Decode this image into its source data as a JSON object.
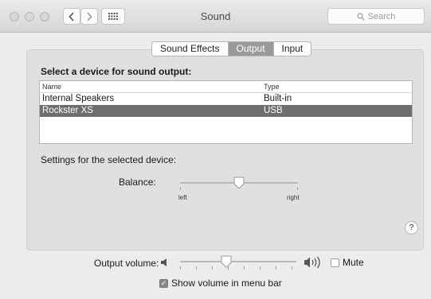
{
  "window": {
    "title": "Sound",
    "search_placeholder": "Search"
  },
  "icons": {
    "back": "chevron-left-icon",
    "forward": "chevron-right-icon",
    "show_all": "grid-icon",
    "search": "magnifier-icon",
    "volume_low": "speaker-low-icon",
    "volume_high": "speaker-high-icon"
  },
  "tabs": [
    {
      "label": "Sound Effects",
      "active": false
    },
    {
      "label": "Output",
      "active": true
    },
    {
      "label": "Input",
      "active": false
    }
  ],
  "output": {
    "heading": "Select a device for sound output:",
    "columns": {
      "name": "Name",
      "type": "Type"
    },
    "devices": [
      {
        "name": "Internal Speakers",
        "type": "Built-in",
        "selected": false
      },
      {
        "name": "Rockster XS",
        "type": "USB",
        "selected": true
      }
    ],
    "settings_label": "Settings for the selected device:",
    "balance": {
      "label": "Balance:",
      "left_label": "left",
      "right_label": "right",
      "value": 0.5
    }
  },
  "footer": {
    "output_volume_label": "Output volume:",
    "output_volume_value": 0.4,
    "mute_label": "Mute",
    "mute_checked": false,
    "show_volume_label": "Show volume in menu bar",
    "show_volume_checked": true,
    "help_label": "?"
  }
}
